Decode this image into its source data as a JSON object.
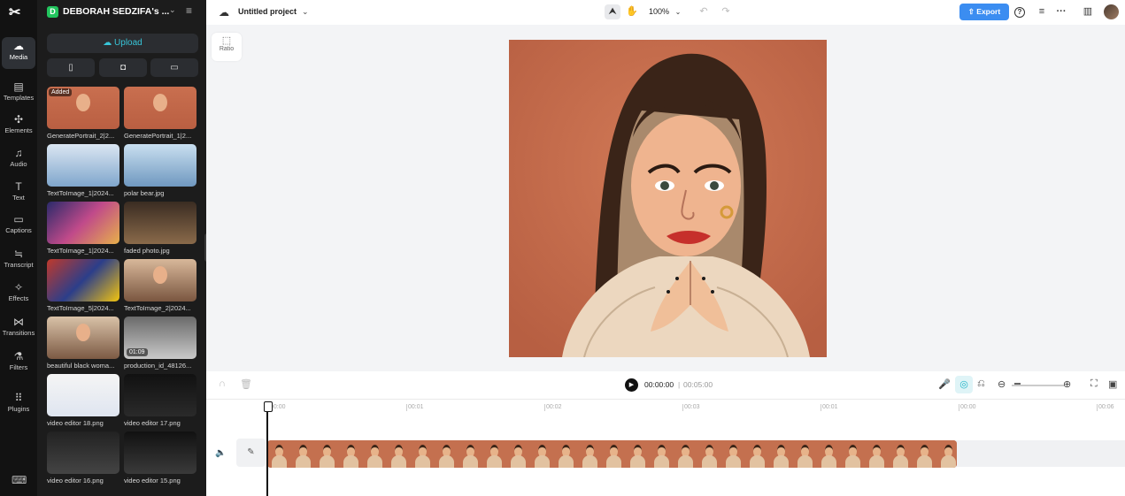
{
  "app": {
    "logo_glyph": "✂"
  },
  "rail": {
    "items": [
      {
        "label": "Media",
        "icon": "media-icon",
        "glyph": "☁"
      },
      {
        "label": "Templates",
        "icon": "templates-icon",
        "glyph": "▤"
      },
      {
        "label": "Elements",
        "icon": "elements-icon",
        "glyph": "✣"
      },
      {
        "label": "Audio",
        "icon": "audio-icon",
        "glyph": "♫"
      },
      {
        "label": "Text",
        "icon": "text-icon",
        "glyph": "T"
      },
      {
        "label": "Captions",
        "icon": "captions-icon",
        "glyph": "▭"
      },
      {
        "label": "Transcript",
        "icon": "transcript-icon",
        "glyph": "≒"
      },
      {
        "label": "Effects",
        "icon": "effects-icon",
        "glyph": "✧"
      },
      {
        "label": "Transitions",
        "icon": "transitions-icon",
        "glyph": "⋈"
      },
      {
        "label": "Filters",
        "icon": "filters-icon",
        "glyph": "⚗"
      },
      {
        "label": "Plugins",
        "icon": "plugins-icon",
        "glyph": "⠿"
      }
    ],
    "keyboard_glyph": "⌨"
  },
  "panel": {
    "workspace_badge": "D",
    "workspace_name": "DEBORAH SEDZIFA's ...",
    "upload_label": "Upload",
    "upload_glyph": "☁",
    "device_glyphs": [
      "▯",
      "◘",
      "▭"
    ],
    "media": [
      {
        "name": "GeneratePortrait_2|2...",
        "tag": "Added",
        "duration": ""
      },
      {
        "name": "GeneratePortrait_1|2...",
        "tag": "",
        "duration": ""
      },
      {
        "name": "TextToImage_1|2024...",
        "tag": "",
        "duration": ""
      },
      {
        "name": "polar bear.jpg",
        "tag": "",
        "duration": ""
      },
      {
        "name": "TextToImage_1|2024...",
        "tag": "",
        "duration": ""
      },
      {
        "name": "faded photo.jpg",
        "tag": "",
        "duration": ""
      },
      {
        "name": "TextToImage_5|2024...",
        "tag": "",
        "duration": ""
      },
      {
        "name": "TextToImage_2|2024...",
        "tag": "",
        "duration": ""
      },
      {
        "name": "beautiful black woma...",
        "tag": "",
        "duration": ""
      },
      {
        "name": "production_id_48126...",
        "tag": "",
        "duration": "01:09"
      },
      {
        "name": "video editor 18.png",
        "tag": "",
        "duration": ""
      },
      {
        "name": "video editor 17.png",
        "tag": "",
        "duration": ""
      },
      {
        "name": "video editor 16.png",
        "tag": "",
        "duration": ""
      },
      {
        "name": "video editor 15.png",
        "tag": "",
        "duration": ""
      }
    ]
  },
  "topbar": {
    "project_title": "Untitled project",
    "zoom": "100%",
    "export_label": "Export",
    "icons": {
      "select": "⮝",
      "hand": "✋",
      "undo": "↶",
      "redo": "↷",
      "help": "?",
      "stack": "≡",
      "more": "···",
      "layout": "▥"
    }
  },
  "canvas": {
    "ratio_label": "Ratio",
    "ratio_glyph": "⬚"
  },
  "timeline": {
    "current_time": "00:00:00",
    "separator": "|",
    "total_time": "00:05:00",
    "ticks": [
      "00:00",
      "00:01",
      "00:02",
      "00:03",
      "00:01",
      "00:00",
      "00:06"
    ],
    "clip_frames": 29
  }
}
